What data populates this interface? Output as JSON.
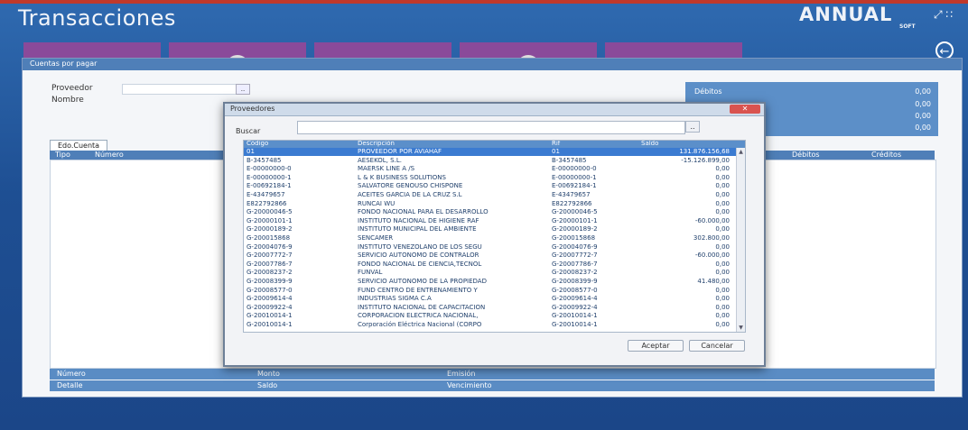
{
  "app": {
    "title": "Transacciones",
    "brand": "ANNUAL",
    "brand_sub": "SOFT",
    "window_controls": "⤢ ∷",
    "back_icon": "←"
  },
  "outer_panel": {
    "title": "Cuentas por pagar",
    "fields": [
      {
        "label": "Proveedor"
      },
      {
        "label": "Nombre"
      }
    ],
    "lookup_button": "..",
    "tab_label": "Edo.Cuenta",
    "grid_headers": [
      "Tipo",
      "Número",
      "Débitos",
      "Créditos"
    ],
    "right_panel": {
      "label": "Débitos",
      "values": [
        "0,00",
        "0,00",
        "0,00",
        "0,00"
      ]
    },
    "footer_row1": [
      "Número",
      "Monto",
      "Emisión"
    ],
    "footer_row2": [
      "Detalle",
      "Saldo",
      "Vencimiento"
    ]
  },
  "dialog": {
    "title": "Proveedores",
    "close_label": "✕",
    "search_label": "Buscar",
    "search_value": "",
    "search_button": "..",
    "columns": [
      "Código",
      "Descripción",
      "Rif",
      "Saldo"
    ],
    "rows": [
      {
        "code": "01",
        "desc": "PROVEEDOR POR AVIAHAF",
        "rif": "01",
        "saldo": "131.876.156,68"
      },
      {
        "code": "B-3457485",
        "desc": "AESEKOL, S.L.",
        "rif": "B-3457485",
        "saldo": "-15.126.899,00"
      },
      {
        "code": "E-00000000-0",
        "desc": "MAERSK LINE A /S",
        "rif": "E-00000000-0",
        "saldo": "0,00"
      },
      {
        "code": "E-00000000-1",
        "desc": "L & K BUSINESS SOLUTIONS",
        "rif": "E-00000000-1",
        "saldo": "0,00"
      },
      {
        "code": "E-00692184-1",
        "desc": "SALVATORE GENOUSO CHISPONE",
        "rif": "E-00692184-1",
        "saldo": "0,00"
      },
      {
        "code": "E-43479657",
        "desc": "ACEITES GARCIA DE LA CRUZ S.L",
        "rif": "E-43479657",
        "saldo": "0,00"
      },
      {
        "code": "E822792866",
        "desc": "RUNCAI WU",
        "rif": "E822792866",
        "saldo": "0,00"
      },
      {
        "code": "G-20000046-5",
        "desc": "FONDO NACIONAL PARA EL DESARROLLO",
        "rif": "G-20000046-5",
        "saldo": "0,00"
      },
      {
        "code": "G-20000101-1",
        "desc": "INSTITUTO NACIONAL DE HIGIENE RAF",
        "rif": "G-20000101-1",
        "saldo": "-60.000,00"
      },
      {
        "code": "G-20000189-2",
        "desc": "INSTITUTO MUNICIPAL DEL AMBIENTE",
        "rif": "G-20000189-2",
        "saldo": "0,00"
      },
      {
        "code": "G-200015868",
        "desc": "SENCAMER",
        "rif": "G-200015868",
        "saldo": "302.800,00"
      },
      {
        "code": "G-20004076-9",
        "desc": "INSTITUTO VENEZOLANO DE LOS SEGU",
        "rif": "G-20004076-9",
        "saldo": "0,00"
      },
      {
        "code": "G-20007772-7",
        "desc": "SERVICIO AUTONOMO DE CONTRALOR",
        "rif": "G-20007772-7",
        "saldo": "-60.000,00"
      },
      {
        "code": "G-20007786-7",
        "desc": "FONDO NACIONAL DE CIENCIA,TECNOL",
        "rif": "G-20007786-7",
        "saldo": "0,00"
      },
      {
        "code": "G-20008237-2",
        "desc": "FUNVAL",
        "rif": "G-20008237-2",
        "saldo": "0,00"
      },
      {
        "code": "G-20008399-9",
        "desc": "SERVICIO AUTONOMO DE LA PROPIEDAD",
        "rif": "G-20008399-9",
        "saldo": "41.480,00"
      },
      {
        "code": "G-20008577-0",
        "desc": "FUND CENTRO DE ENTRENAMIENTO Y",
        "rif": "G-20008577-0",
        "saldo": "0,00"
      },
      {
        "code": "G-20009614-4",
        "desc": "INDUSTRIAS SIGMA C.A",
        "rif": "G-20009614-4",
        "saldo": "0,00"
      },
      {
        "code": "G-20009922-4",
        "desc": "INSTITUTO NACIONAL DE CAPACITACION",
        "rif": "G-20009922-4",
        "saldo": "0,00"
      },
      {
        "code": "G-20010014-1",
        "desc": "CORPORACION ELECTRICA NACIONAL,",
        "rif": "G-20010014-1",
        "saldo": "0,00"
      },
      {
        "code": "G-20010014-1",
        "desc": "Corporación Eléctrica Nacional (CORPO",
        "rif": "G-20010014-1",
        "saldo": "0,00"
      }
    ],
    "accept_label": "Aceptar",
    "cancel_label": "Cancelar"
  }
}
